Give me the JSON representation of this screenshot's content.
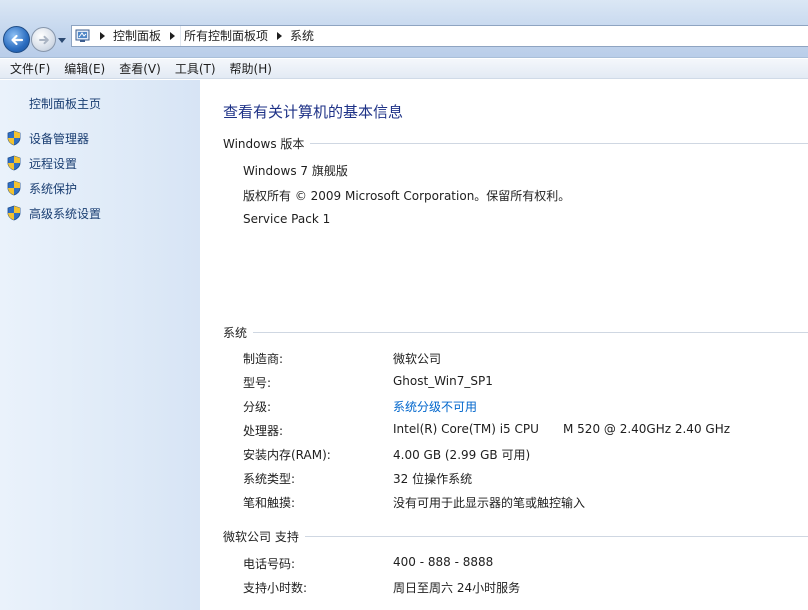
{
  "colors": {
    "title_blue": "#1e3287",
    "link_blue": "#0066cc",
    "sidebar_text": "#1a3e72"
  },
  "address_bar": {
    "icon": "control-panel-icon",
    "crumbs": [
      "控制面板",
      "所有控制面板项",
      "系统"
    ]
  },
  "menu": [
    "文件(F)",
    "编辑(E)",
    "查看(V)",
    "工具(T)",
    "帮助(H)"
  ],
  "sidebar": {
    "home": "控制面板主页",
    "items": [
      {
        "label": "设备管理器",
        "icon": "uac-shield-icon"
      },
      {
        "label": "远程设置",
        "icon": "uac-shield-icon"
      },
      {
        "label": "系统保护",
        "icon": "uac-shield-icon"
      },
      {
        "label": "高级系统设置",
        "icon": "uac-shield-icon"
      }
    ]
  },
  "main": {
    "title": "查看有关计算机的基本信息",
    "windows_edition": {
      "heading": "Windows 版本",
      "lines": [
        "Windows 7 旗舰版",
        "版权所有 © 2009 Microsoft Corporation。保留所有权利。",
        "Service Pack 1"
      ]
    },
    "system": {
      "heading": "系统",
      "rows": [
        {
          "label": "制造商:",
          "value": "微软公司"
        },
        {
          "label": "型号:",
          "value": "Ghost_Win7_SP1"
        },
        {
          "label": "分级:",
          "value": "系统分级不可用"
        },
        {
          "label": "处理器:",
          "value": "Intel(R) Core(TM) i5 CPU",
          "value2": "M 520  @ 2.40GHz   2.40 GHz"
        },
        {
          "label": "安装内存(RAM):",
          "value": "4.00 GB (2.99 GB 可用)"
        },
        {
          "label": "系统类型:",
          "value": "32 位操作系统"
        },
        {
          "label": "笔和触摸:",
          "value": "没有可用于此显示器的笔或触控输入"
        }
      ]
    },
    "support": {
      "heading": "微软公司 支持",
      "rows": [
        {
          "label": "电话号码:",
          "value": "400 - 888 - 8888"
        },
        {
          "label": "支持小时数:",
          "value": "周日至周六  24小时服务"
        }
      ]
    }
  }
}
